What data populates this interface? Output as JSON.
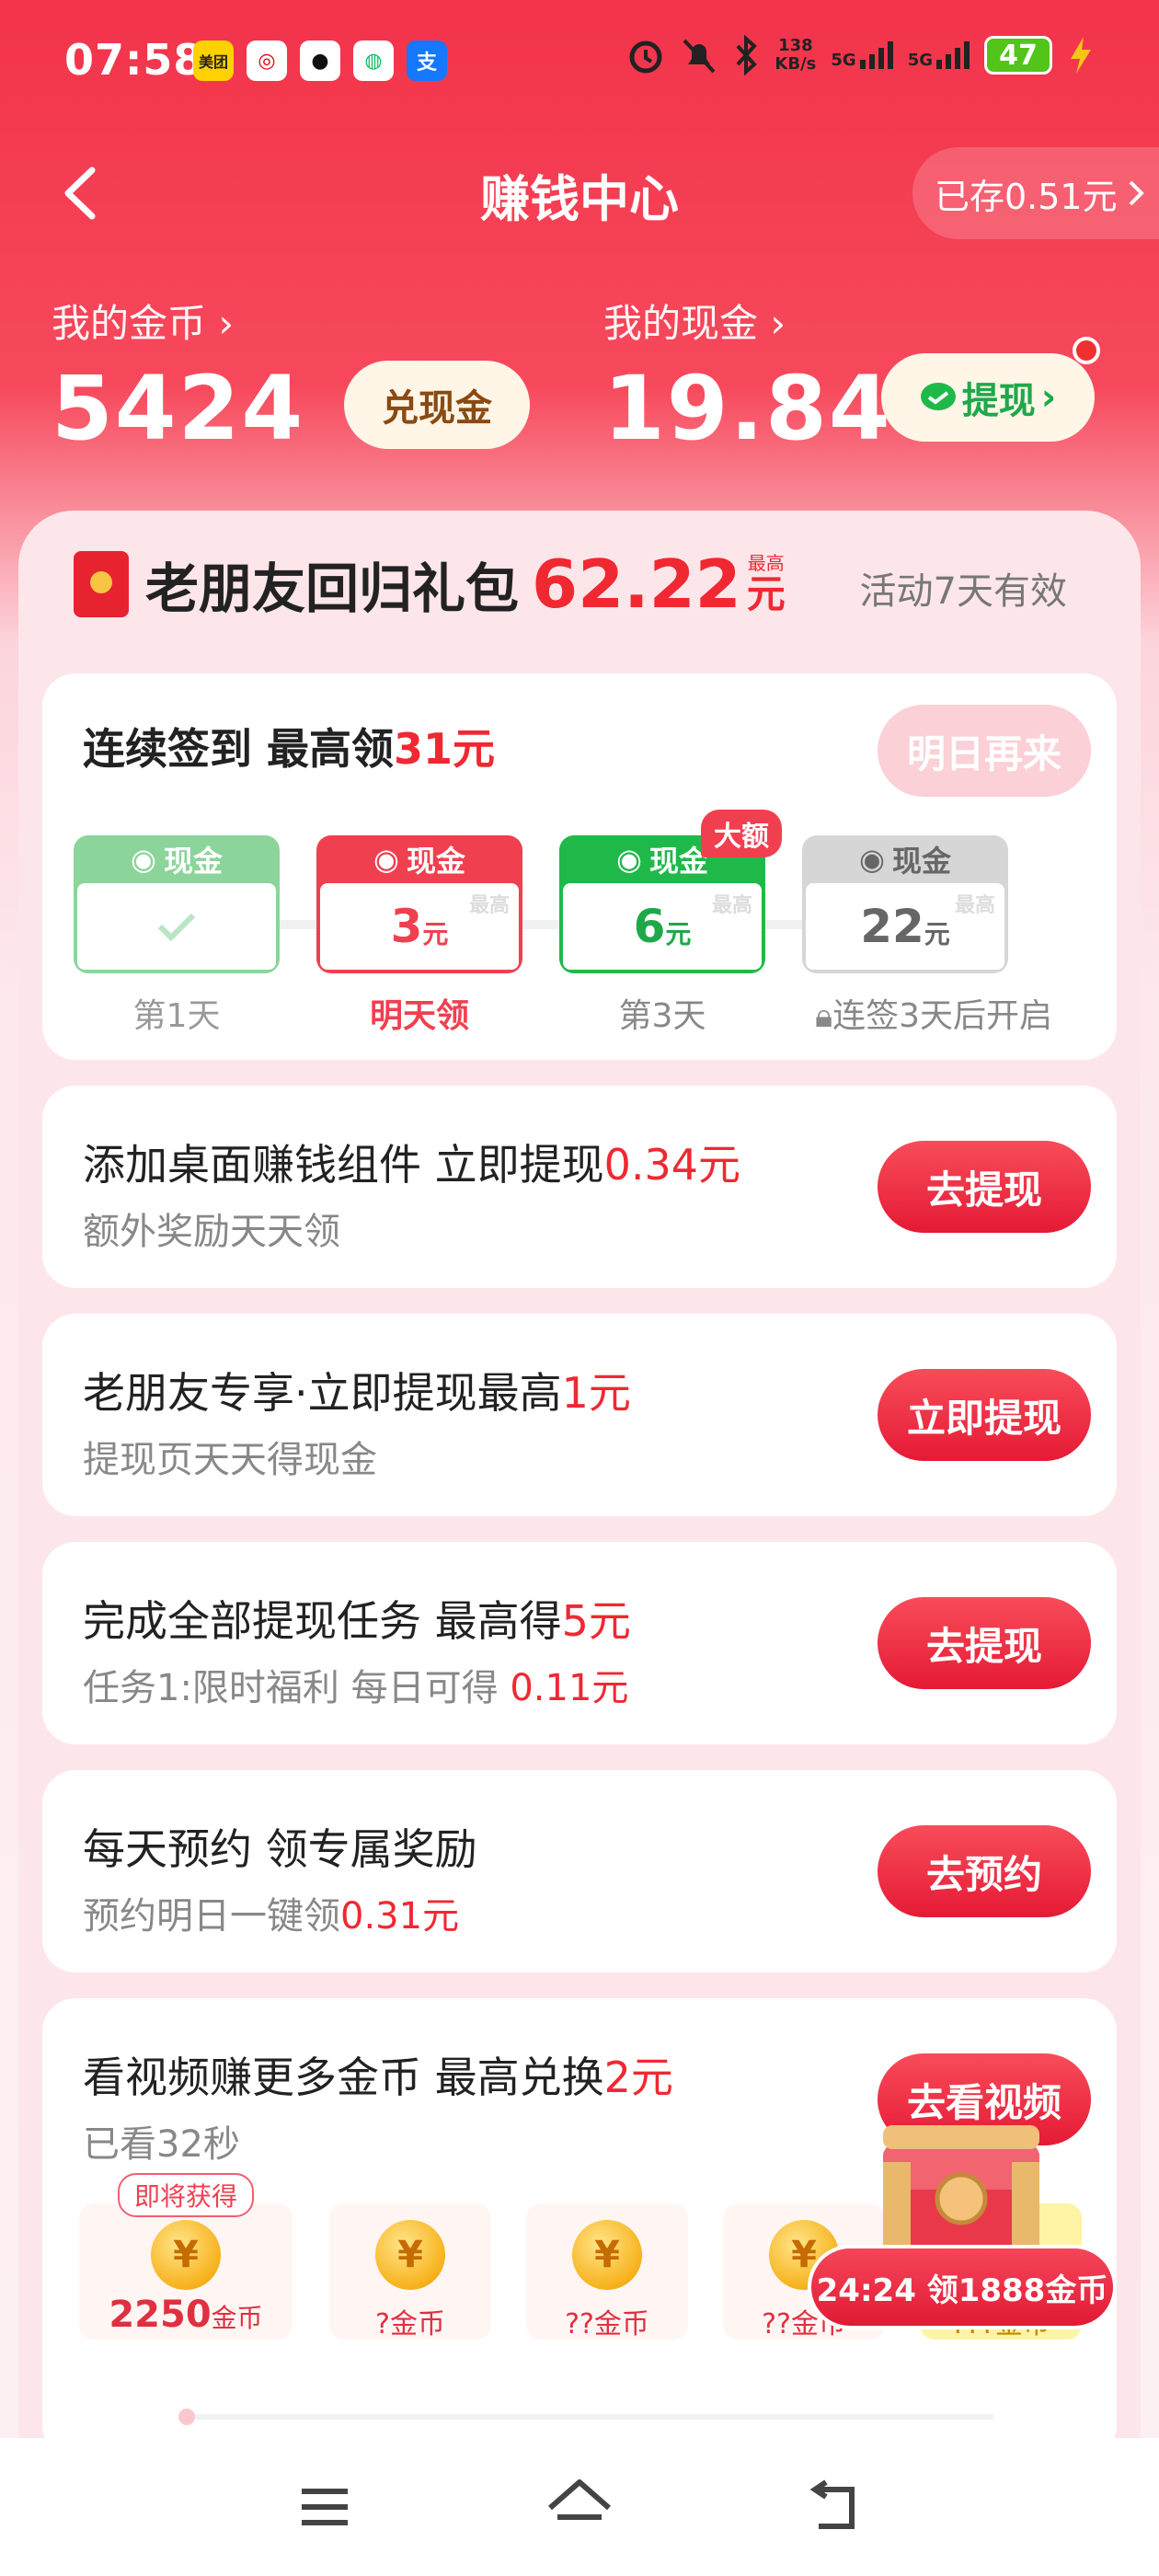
{
  "status_bar": {
    "time": "07:58",
    "net_speed_value": "138",
    "net_speed_unit": "KB/s",
    "sim1": "5G",
    "sim2": "5G",
    "battery": "47"
  },
  "header": {
    "title": "赚钱中心",
    "saved_label": "已存0.51元",
    "back_icon": "chevron-left-icon"
  },
  "wallet": {
    "coins_label": "我的金币",
    "coins_value": "5424",
    "exchange_button": "兑现金",
    "cash_label": "我的现金",
    "cash_value": "19.84",
    "withdraw_button": "提现"
  },
  "gift": {
    "title": "老朋友回归礼包",
    "amount": "62.22",
    "max_small": "最高",
    "unit": "元",
    "validity": "活动7天有效"
  },
  "checkin": {
    "title": "连续签到 最高领",
    "title_amount": "31元",
    "button": "明日再来",
    "days": [
      {
        "top": "现金",
        "value": "",
        "unit": "",
        "label": "第1天",
        "checked": true,
        "color": "#7fd08f"
      },
      {
        "top": "现金",
        "value": "3",
        "unit": "元",
        "max": "最高",
        "label": "明天领",
        "color": "#f0404f"
      },
      {
        "top": "现金",
        "value": "6",
        "unit": "元",
        "max": "最高",
        "label": "第3天",
        "badge": "大额",
        "color": "#1fb94a"
      },
      {
        "top": "现金",
        "value": "22",
        "unit": "元",
        "max": "最高",
        "label": "连签3天后开启",
        "color": "#d0d0d0"
      }
    ]
  },
  "tasks": [
    {
      "title": "添加桌面赚钱组件 立即提现",
      "title_highlight": "0.34元",
      "sub": "额外奖励天天领",
      "sub_highlight": "",
      "button": "去提现"
    },
    {
      "title": "老朋友专享·立即提现最高",
      "title_highlight": "1元",
      "sub": "提现页天天得现金",
      "sub_highlight": "",
      "button": "立即提现"
    },
    {
      "title": "完成全部提现任务 最高得",
      "title_highlight": "5元",
      "sub": "任务1:限时福利 每日可得 ",
      "sub_highlight": "0.11元",
      "button": "去提现"
    },
    {
      "title": "每天预约 领专属奖励",
      "title_highlight": "",
      "sub": "预约明日一键领",
      "sub_highlight": "0.31元",
      "button": "去预约"
    }
  ],
  "video": {
    "title": "看视频赚更多金币 最高兑换",
    "title_highlight": "2元",
    "sub": "已看32秒",
    "button": "去看视频",
    "coming_tag": "即将获得",
    "coins": [
      {
        "value": "2250",
        "unit": "金币"
      },
      {
        "value": "?",
        "unit": "金币"
      },
      {
        "value": "??",
        "unit": "金币"
      },
      {
        "value": "??",
        "unit": "金币"
      },
      {
        "value": "???",
        "unit": "金币"
      }
    ],
    "chest_timer": "24:24 领1888金币"
  },
  "nav": {
    "menu_icon": "menu-icon",
    "home_icon": "home-icon",
    "back_icon": "back-icon"
  }
}
